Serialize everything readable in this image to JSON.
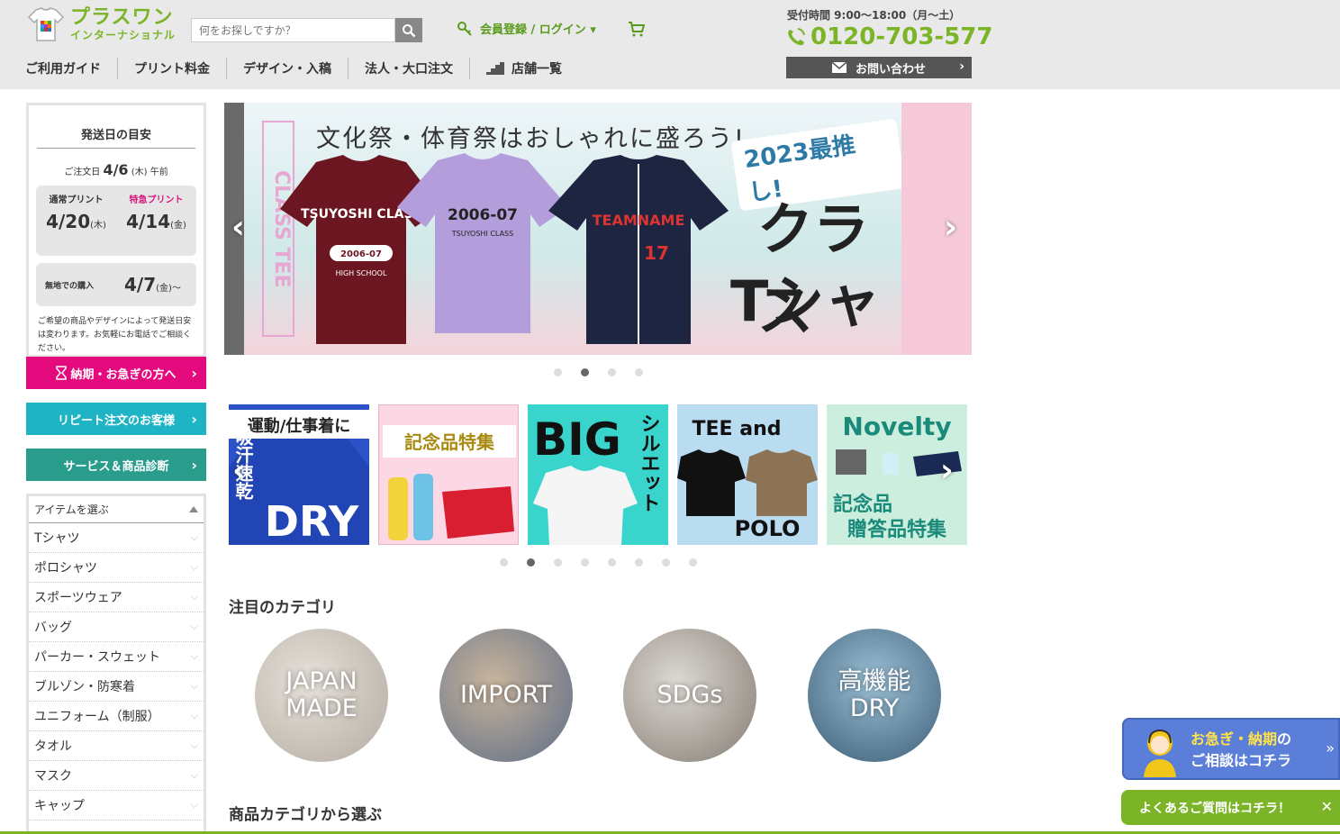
{
  "header": {
    "logo_main": "プラスワン",
    "logo_sub": "インターナショナル",
    "search_placeholder": "何をお探しですか？",
    "login_label": "会員登録 / ログイン ▾",
    "hours": "受付時間 9:00～18:00（月～土）",
    "phone": "0120-703-577",
    "contact_label": "お問い合わせ",
    "nav": [
      "ご利用ガイド",
      "プリント料金",
      "デザイン・入稿",
      "法人・大口注文",
      "店舗一覧"
    ]
  },
  "shipping": {
    "title": "発送日の目安",
    "order_prefix": "ご注文日",
    "order_date": "4/6",
    "order_day": "(木)",
    "order_suffix": "午前",
    "normal_label": "通常プリント",
    "normal_date": "4/20",
    "normal_day": "(木)",
    "express_label": "特急プリント",
    "express_date": "4/14",
    "express_day": "(金)",
    "plain_label": "無地での購入",
    "plain_date": "4/7",
    "plain_day": "(金)～",
    "note": "ご希望の商品やデザインによって発送日安は変わります。お気軽にお電話でご相談ください。"
  },
  "sidebar_buttons": {
    "urgent": "納期・お急ぎの方へ",
    "repeat": "リピート注文のお客様",
    "diagnosis": "サービス＆商品診断"
  },
  "item_list": {
    "head": "アイテムを選ぶ",
    "items": [
      "Tシャツ",
      "ポロシャツ",
      "スポーツウェア",
      "バッグ",
      "パーカー・スウェット",
      "ブルゾン・防寒着",
      "ユニフォーム（制服）",
      "タオル",
      "マスク",
      "キャップ"
    ]
  },
  "hero": {
    "headline": "文化祭・体育祭はおしゃれに盛ろう!",
    "badge": "2023最推し!",
    "big1": "クラス",
    "big2": "Tシャツ",
    "vertical": "CLASS TEE",
    "shirt1_line1": "TSUYOSHI CLASS",
    "shirt1_line2": "2006-07",
    "shirt1_line3": "HIGH SCHOOL",
    "shirt2_line1": "2006-07",
    "shirt2_line2": "TSUYOSHI CLASS",
    "shirt3_line1": "TEAMNAME",
    "shirt3_line2": "17",
    "active_dot": 2,
    "dot_count": 4
  },
  "banners": {
    "b1_line1": "運動/仕事着に",
    "b1_side": "吸汗速乾",
    "b1_big": "DRY",
    "b2_title": "記念品特集",
    "b3_big": "BIG",
    "b3_side": "シルエット",
    "b4_top": "TEE and",
    "b4_bottom": "POLO",
    "b5_top": "Novelty",
    "b5_line1": "記念品",
    "b5_line2": "贈答品特集",
    "active_dot": 2,
    "dot_count": 8
  },
  "featured": {
    "title": "注目のカテゴリ",
    "items": [
      "JAPAN MADE",
      "IMPORT",
      "SDGs",
      "高機能 DRY"
    ]
  },
  "product_section_title": "商品カテゴリから選ぶ",
  "floating": {
    "urgent_line1a": "お急ぎ・納期",
    "urgent_line1b": "の",
    "urgent_line2a": "ご相談",
    "urgent_line2b": "はコチラ",
    "faq": "よくあるご質問はコチラ！"
  },
  "colors": {
    "brand_green": "#7bb527",
    "pink": "#e4097d",
    "teal": "#1eb3c5",
    "dark_teal": "#2a9c8c"
  }
}
